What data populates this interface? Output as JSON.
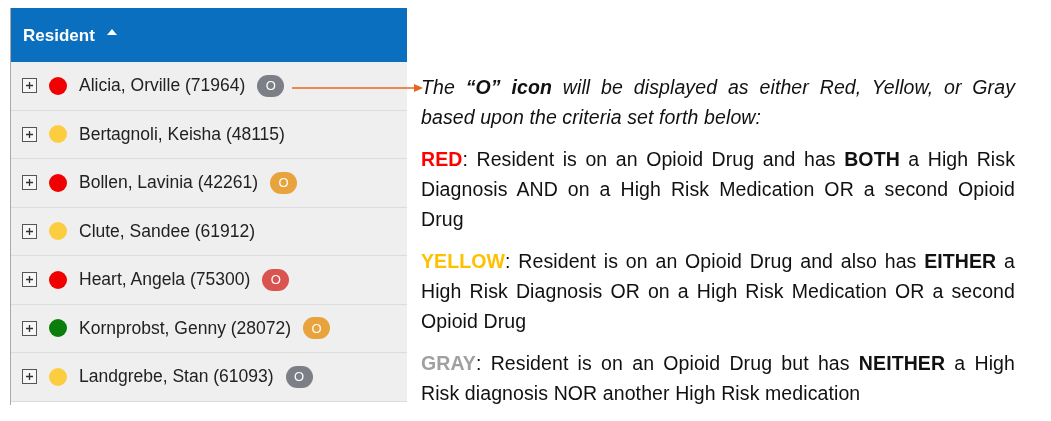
{
  "table": {
    "column_header": {
      "label": "Resident",
      "sorted_ascending": true
    },
    "rows": [
      {
        "name": "Alicia, Orville (71964)",
        "expanded": false,
        "color": "#f00000",
        "badge": {
          "text": "O",
          "color": "#7d7f87"
        }
      },
      {
        "name": "Bertagnoli, Keisha (48115)",
        "expanded": false,
        "color": "#fccd3f"
      },
      {
        "name": "Bollen, Lavinia (42261)",
        "expanded": false,
        "color": "#f00000",
        "badge": {
          "text": "O",
          "color": "#e8a33d"
        }
      },
      {
        "name": "Clute, Sandee (61912)",
        "expanded": false,
        "color": "#fccd3f"
      },
      {
        "name": "Heart, Angela (75300)",
        "expanded": false,
        "color": "#f00000",
        "badge": {
          "text": "O",
          "color": "#d9534f"
        }
      },
      {
        "name": "Kornprobst, Genny (28072)",
        "expanded": false,
        "color": "#0a7d0a",
        "badge": {
          "text": "O",
          "color": "#e8a33d"
        }
      },
      {
        "name": "Landgrebe, Stan (61093)",
        "expanded": false,
        "color": "#fccd3f",
        "badge": {
          "text": "O",
          "color": "#7d7f87"
        }
      }
    ]
  },
  "annotation": {
    "intro": "The **“O” icon** will be displayed as either Red, Yellow, or Gray based upon the criteria set forth below:",
    "criteria": [
      {
        "label": "RED",
        "color": "#ff0000",
        "text": ": Resident is on an Opioid Drug and has **BOTH** a High Risk Diagnosis AND on a High Risk Medication OR a second Opioid Drug"
      },
      {
        "label": "YELLOW",
        "color": "#ffc000",
        "text": ": Resident is on an Opioid Drug and also has **EITHER** a High Risk Diagnosis OR on a High Risk Medication OR a second Opioid Drug"
      },
      {
        "label": "GRAY",
        "color": "#a0a0a0",
        "text": ": Resident is on an Opioid Drug but has **NEITHER** a High Risk diagnosis NOR another High Risk medication"
      }
    ]
  }
}
